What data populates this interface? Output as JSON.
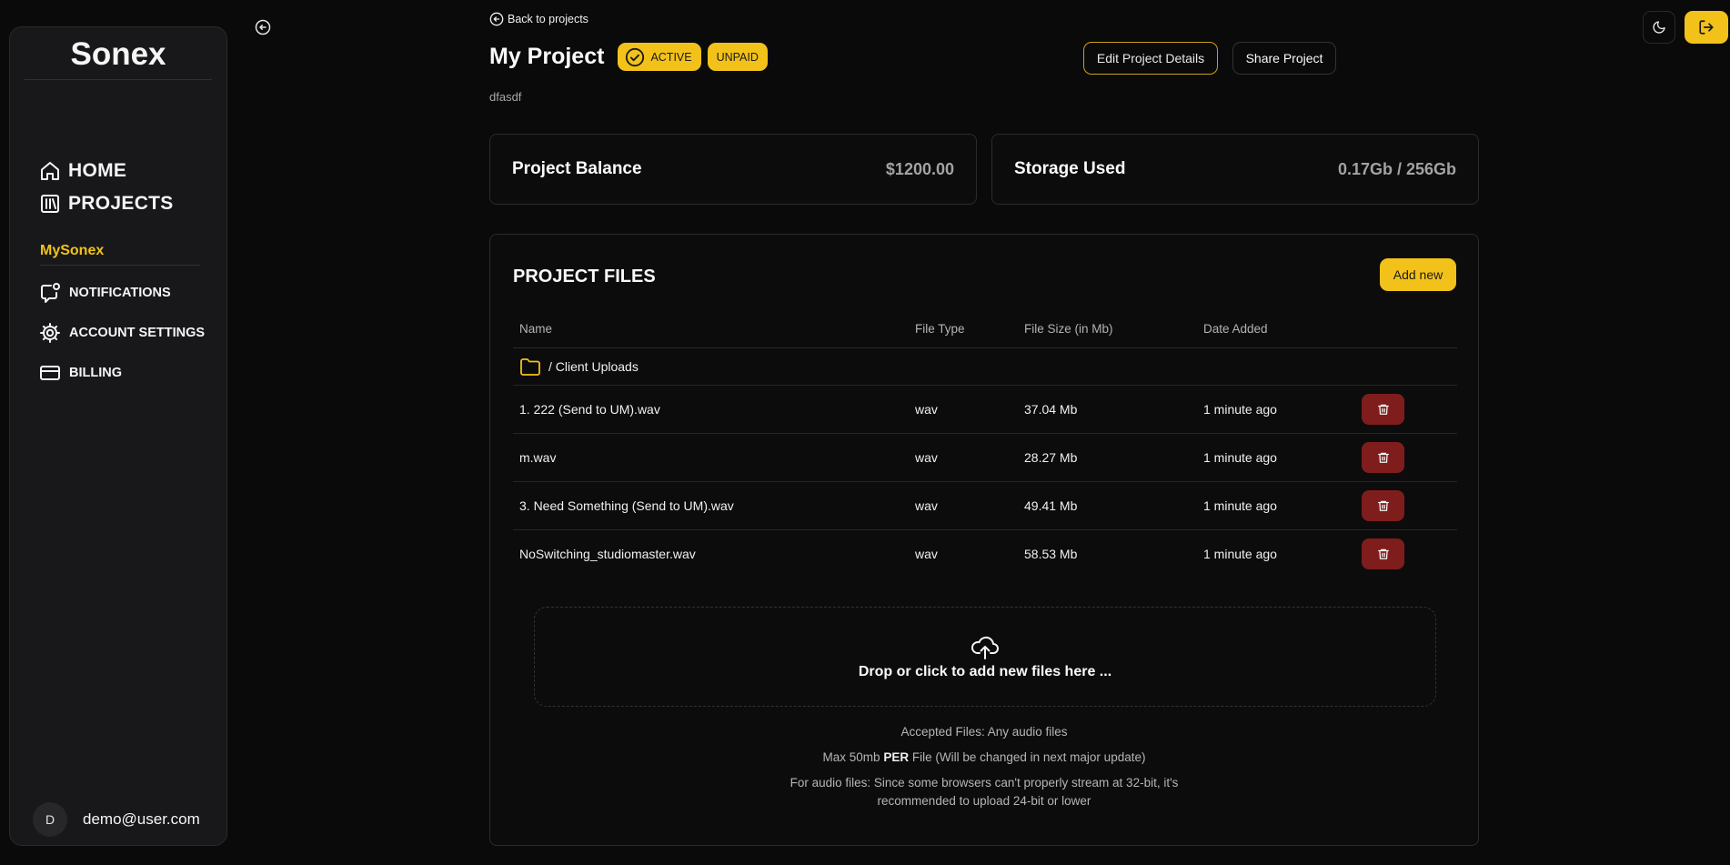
{
  "sidebar": {
    "brand": "Sonex",
    "main_nav": [
      {
        "label": "HOME",
        "icon": "home-icon"
      },
      {
        "label": "PROJECTS",
        "icon": "library-icon"
      }
    ],
    "section_title": "MySonex",
    "sub_nav": [
      {
        "label": "NOTIFICATIONS",
        "icon": "notification-icon"
      },
      {
        "label": "ACCOUNT SETTINGS",
        "icon": "gear-icon"
      },
      {
        "label": "BILLING",
        "icon": "credit-card-icon"
      }
    ],
    "user": {
      "initial": "D",
      "email": "demo@user.com"
    }
  },
  "header": {
    "back_label": "Back to projects",
    "title": "My Project",
    "badges": {
      "status": "ACTIVE",
      "payment": "UNPAID"
    },
    "description": "dfasdf",
    "edit_label": "Edit Project Details",
    "share_label": "Share Project"
  },
  "stats": {
    "balance": {
      "label": "Project Balance",
      "value": "$1200.00"
    },
    "storage": {
      "label": "Storage Used",
      "value": "0.17Gb / 256Gb"
    }
  },
  "files": {
    "title": "PROJECT FILES",
    "add_label": "Add new",
    "columns": [
      "Name",
      "File Type",
      "File Size (in Mb)",
      "Date Added"
    ],
    "folder": "/ Client Uploads",
    "rows": [
      {
        "name": "1. 222 (Send to UM).wav",
        "type": "wav",
        "size": "37.04 Mb",
        "date": "1 minute ago"
      },
      {
        "name": "m.wav",
        "type": "wav",
        "size": "28.27 Mb",
        "date": "1 minute ago"
      },
      {
        "name": "3. Need Something (Send to UM).wav",
        "type": "wav",
        "size": "49.41 Mb",
        "date": "1 minute ago"
      },
      {
        "name": "NoSwitching_studiomaster.wav",
        "type": "wav",
        "size": "58.53 Mb",
        "date": "1 minute ago"
      }
    ],
    "dropzone_text": "Drop or click to add new files here ...",
    "notes": {
      "accepted": "Accepted Files: Any audio files",
      "max_prefix": "Max 50mb",
      "max_bold": "PER",
      "max_suffix": "File (Will be changed in next major update)",
      "audio_line1": "For audio files: Since some browsers can't properly stream at 32-bit, it's",
      "audio_line2": "recommended to upload 24-bit or lower"
    }
  },
  "colors": {
    "accent": "#f2c21a",
    "danger": "#7f1d1d",
    "background": "#0a0a0a"
  }
}
